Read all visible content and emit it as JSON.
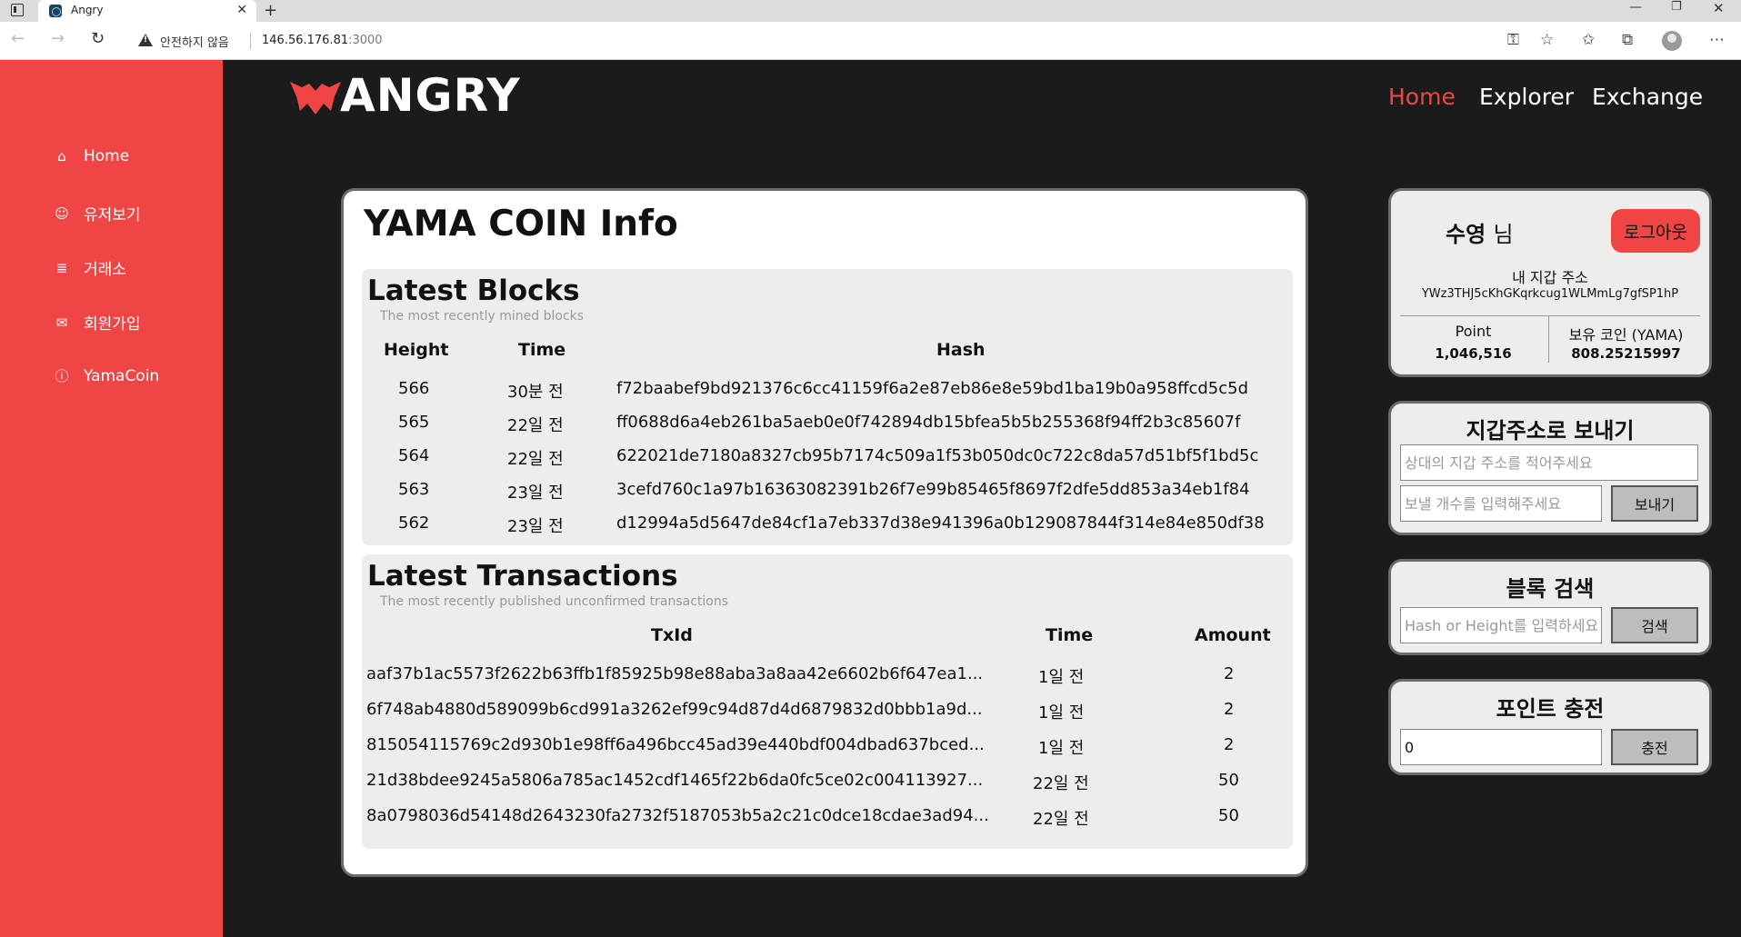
{
  "browser": {
    "tab_title": "Angry",
    "tab_close": "✕",
    "new_tab": "+",
    "security_label": "안전하지 않음",
    "url_host": "146.56.176.81",
    "url_port": ":3000"
  },
  "sidebar": {
    "items": [
      {
        "label": "Home",
        "icon": "home-icon"
      },
      {
        "label": "유저보기",
        "icon": "user-icon"
      },
      {
        "label": "거래소",
        "icon": "database-icon"
      },
      {
        "label": "회원가입",
        "icon": "envelope-icon"
      },
      {
        "label": "YamaCoin",
        "icon": "info-icon"
      }
    ]
  },
  "header": {
    "logo_text": "ANGRY",
    "nav": [
      "Home",
      "Explorer",
      "Exchange"
    ],
    "active_color": "#f04545"
  },
  "main": {
    "title": "YAMA COIN Info",
    "blocks": {
      "title": "Latest Blocks",
      "subtitle": "The most recently mined blocks",
      "headers": [
        "Height",
        "Time",
        "Hash"
      ],
      "rows": [
        {
          "height": "566",
          "time": "30분 전",
          "hash": "f72baabef9bd921376c6cc41159f6a2e87eb86e8e59bd1ba19b0a958ffcd5c5d"
        },
        {
          "height": "565",
          "time": "22일 전",
          "hash": "ff0688d6a4eb261ba5aeb0e0f742894db15bfea5b5b255368f94ff2b3c85607f"
        },
        {
          "height": "564",
          "time": "22일 전",
          "hash": "622021de7180a8327cb95b7174c509a1f53b050dc0c722c8da57d51bf5f1bd5c"
        },
        {
          "height": "563",
          "time": "23일 전",
          "hash": "3cefd760c1a97b16363082391b26f7e99b85465f8697f2dfe5dd853a34eb1f84"
        },
        {
          "height": "562",
          "time": "23일 전",
          "hash": "d12994a5d5647de84cf1a7eb337d38e941396a0b129087844f314e84e850df38"
        }
      ]
    },
    "transactions": {
      "title": "Latest Transactions",
      "subtitle": "The most recently published unconfirmed transactions",
      "headers": [
        "TxId",
        "Time",
        "Amount"
      ],
      "rows": [
        {
          "txid": "aaf37b1ac5573f2622b63ffb1f85925b98e88aba3a8aa42e6602b6f647ea1...",
          "time": "1일 전",
          "amount": "2"
        },
        {
          "txid": "6f748ab4880d589099b6cd991a3262ef99c94d87d4d6879832d0bbb1a9d...",
          "time": "1일 전",
          "amount": "2"
        },
        {
          "txid": "815054115769c2d930b1e98ff6a496bcc45ad39e440bdf004dbad637bced...",
          "time": "1일 전",
          "amount": "2"
        },
        {
          "txid": "21d38bdee9245a5806a785ac1452cdf1465f22b6da0fc5ce02c004113927...",
          "time": "22일 전",
          "amount": "50"
        },
        {
          "txid": "8a0798036d54148d2643230fa2732f5187053b5a2c21c0dce18cdae3ad94...",
          "time": "22일 전",
          "amount": "50"
        }
      ]
    }
  },
  "user_panel": {
    "name": "수영",
    "honorific": "님",
    "logout_label": "로그아웃",
    "wallet_label": "내 지갑 주소",
    "wallet_address": "YWz3THJ5cKhGKqrkcug1WLMmLg7gfSP1hP",
    "point_label": "Point",
    "point_value": "1,046,516",
    "coin_label": "보유 코인 (YAMA)",
    "coin_value": "808.25215997"
  },
  "send_panel": {
    "title": "지갑주소로 보내기",
    "address_placeholder": "상대의 지갑 주소를 적어주세요",
    "amount_placeholder": "보낼 개수를 입력해주세요",
    "button_label": "보내기"
  },
  "search_panel": {
    "title": "블록 검색",
    "placeholder": "Hash or Height를 입력하세요",
    "button_label": "검색"
  },
  "charge_panel": {
    "title": "포인트 충전",
    "value": "0",
    "button_label": "충전"
  }
}
